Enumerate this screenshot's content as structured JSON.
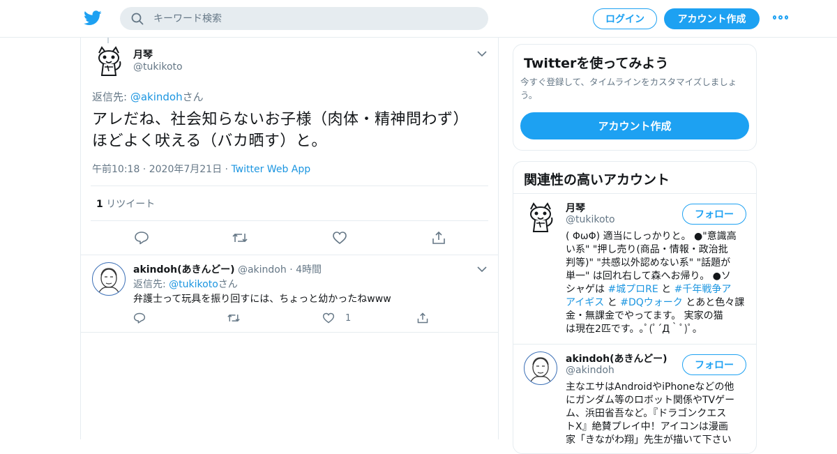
{
  "header": {
    "search_placeholder": "キーワード検索",
    "login_label": "ログイン",
    "signup_label": "アカウント作成"
  },
  "main_tweet": {
    "display_name": "月琴",
    "handle": "@tukikoto",
    "reply_prefix": "返信先: ",
    "reply_to": "@akindoh",
    "reply_suffix": "さん",
    "text_line1": "アレだね、社会知らないお子様（肉体・精神問わず）",
    "text_line2": "ほどよく吠える（バカ晒す）と。",
    "time": "午前10:18",
    "date": "2020年7月21日",
    "source": "Twitter Web App",
    "retweet_count": "1",
    "retweet_label": "リツイート"
  },
  "reply_tweet": {
    "display_name": "akindoh(あきんどー)",
    "handle": "@akindoh",
    "time_ago": "4時間",
    "reply_prefix": "返信先: ",
    "reply_to": "@tukikoto",
    "reply_suffix": "さん",
    "text": "弁護士って玩具を振り回すには、ちょっと幼かったねwww",
    "like_count": "1"
  },
  "signup_card": {
    "title": "Twitterを使ってみよう",
    "description_line1": "今すぐ登録して、タイムラインをカスタマイズしましょ",
    "description_line2": "う。",
    "button_label": "アカウント作成"
  },
  "related_card": {
    "title": "関連性の高いアカウント",
    "accounts": [
      {
        "display_name": "月琴",
        "handle": "@tukikoto",
        "follow_label": "フォロー",
        "bio_lines": [
          "( ΦωΦ) 適当にしっかりと。 ●\"意識高",
          "い系\" \"押し売り(商品・情報・政治批",
          "判等)\" \"共感以外認めない系\" \"話題が",
          "単一\" は回れ右して森へお帰り。 ●ソ",
          "シャゲは ",
          "アイギス",
          "とあと色々課",
          "金・無課金でやってます。 実家の猫",
          "は現在2匹です。｡ﾟ(ﾟ´Д｀ﾟ)ﾟ｡"
        ],
        "hashtags": [
          "#城プロRE",
          "#千年戦争ア",
          "#DQウォーク"
        ],
        "conj_to": "と",
        "conj_to2": "と"
      },
      {
        "display_name": "akindoh(あきんどー)",
        "handle": "@akindoh",
        "follow_label": "フォロー",
        "bio_lines": [
          "主なエサはAndroidやiPhoneなどの他",
          "にガンダム等のロボット関係やTVゲー",
          "ム、浜田省吾など。『ドラゴンクエス",
          "トX』絶賛プレイ中！アイコンは漫画",
          "家「きながわ翔」先生が描いて下さい"
        ]
      }
    ]
  },
  "colors": {
    "accent": "#1da1f2",
    "link": "#1b95e0",
    "muted": "#657786",
    "border": "#e6ecf0"
  }
}
